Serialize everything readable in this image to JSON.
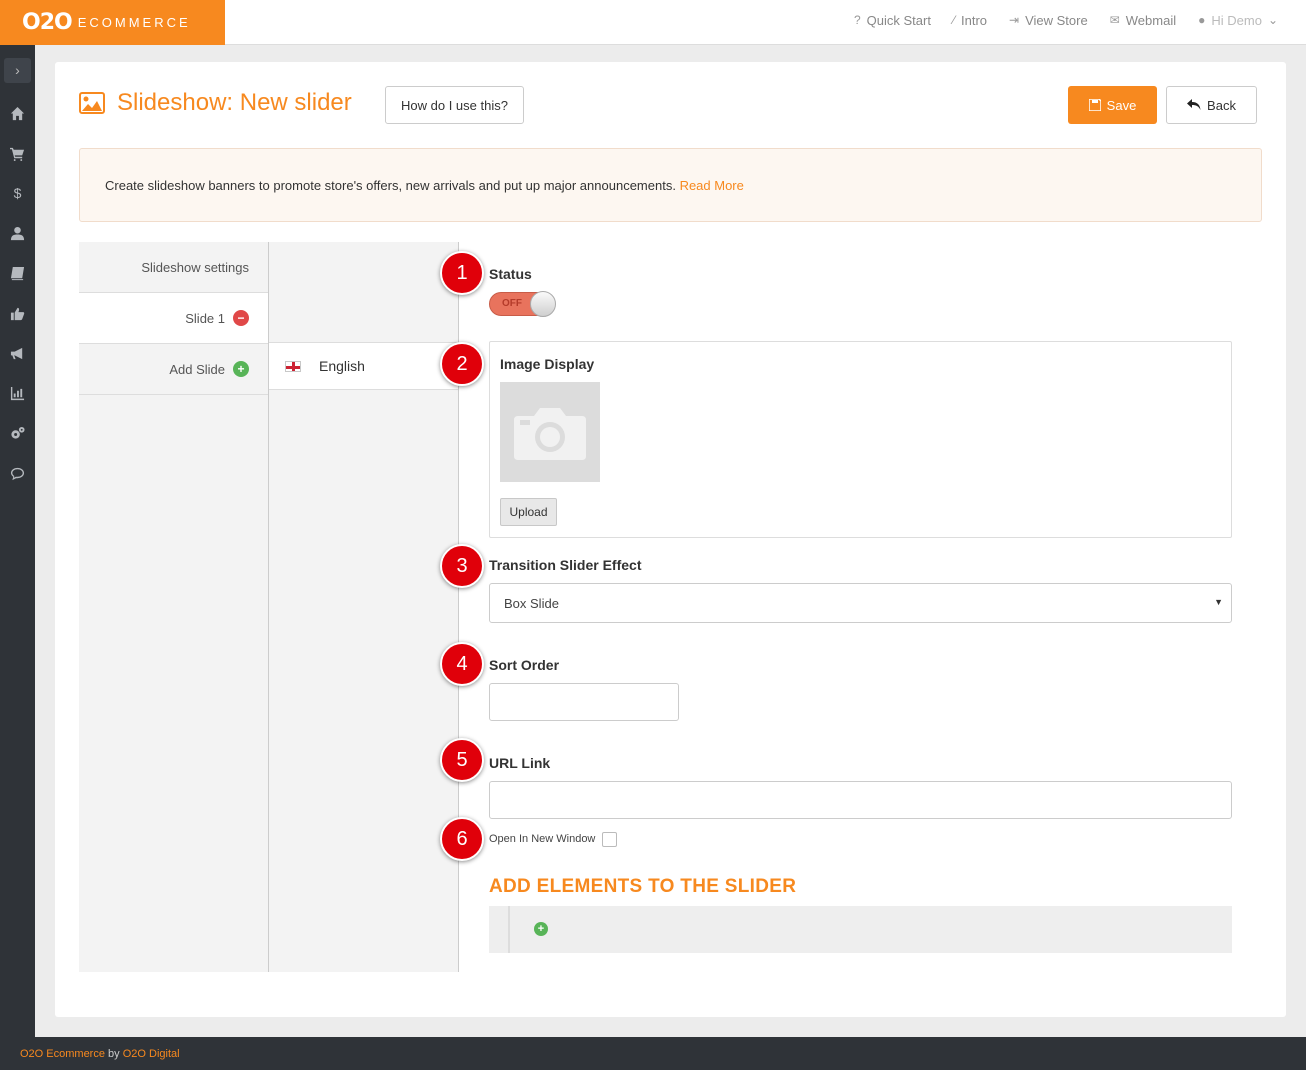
{
  "brand": {
    "logo_main": "O2O",
    "logo_sub": "ECOMMERCE",
    "accent": "#f7891f"
  },
  "topnav": {
    "items": [
      {
        "icon": "question-icon",
        "label": "Quick Start"
      },
      {
        "icon": "wand-icon",
        "label": "Intro"
      },
      {
        "icon": "sign-in-icon",
        "label": "View Store"
      },
      {
        "icon": "envelope-icon",
        "label": "Webmail"
      }
    ],
    "user": {
      "icon": "user-icon",
      "label": "Hi Demo"
    }
  },
  "sidebar": {
    "icons": [
      "home-icon",
      "cart-icon",
      "dollar-icon",
      "user-icon",
      "book-icon",
      "thumbs-up-icon",
      "megaphone-icon",
      "bar-chart-icon",
      "gears-icon",
      "comment-icon"
    ]
  },
  "page": {
    "title": "Slideshow: New slider",
    "help_button": "How do I use this?",
    "save_button": "Save",
    "back_button": "Back"
  },
  "info": {
    "text": "Create slideshow banners to promote store's offers, new arrivals and put up major announcements.",
    "link": "Read More"
  },
  "left_tabs": {
    "settings": "Slideshow settings",
    "slide1": "Slide 1",
    "add_slide": "Add Slide"
  },
  "language": {
    "label": "English"
  },
  "form": {
    "status_label": "Status",
    "status_value": "OFF",
    "image_label": "Image Display",
    "upload_button": "Upload",
    "transition_label": "Transition Slider Effect",
    "transition_value": "Box Slide",
    "sort_label": "Sort Order",
    "sort_value": "",
    "url_label": "URL Link",
    "url_value": "",
    "new_window_label": "Open In New Window",
    "new_window_checked": false,
    "elements_title": "ADD ELEMENTS TO THE SLIDER"
  },
  "badges": [
    "1",
    "2",
    "3",
    "4",
    "5",
    "6"
  ],
  "footer": {
    "company": "O2O Ecommerce",
    "by": "by",
    "author": "O2O Digital"
  }
}
